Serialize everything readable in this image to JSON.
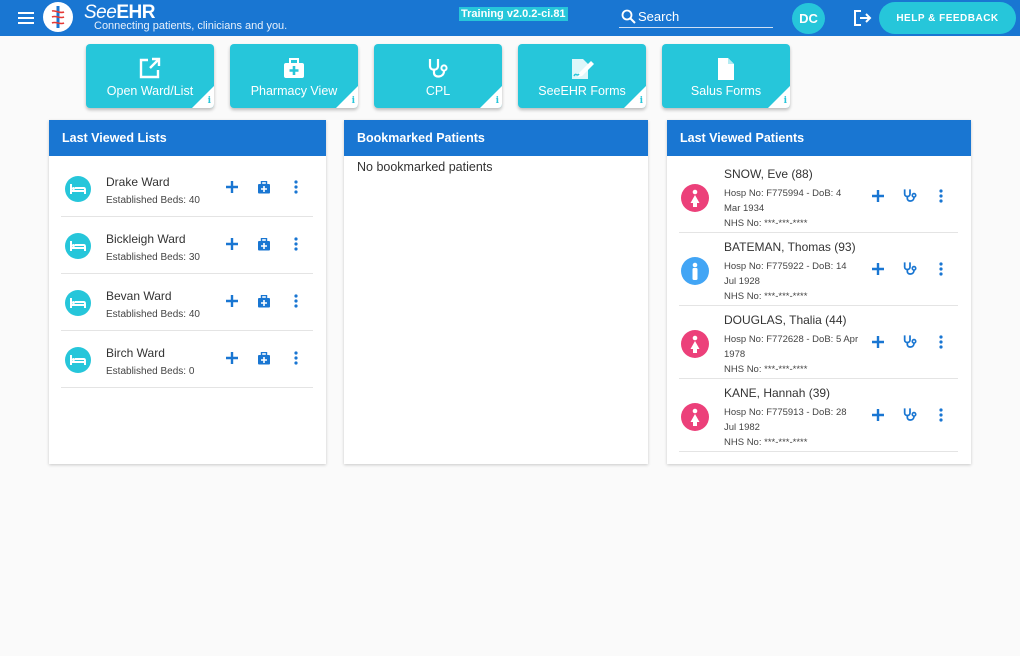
{
  "header": {
    "brand_prefix": "See",
    "brand_suffix": "EHR",
    "tagline": "Connecting patients, clinicians and you.",
    "environment": "Training v2.0.2-ci.81",
    "search_placeholder": "Search",
    "user_initials": "DC",
    "help_label": "HELP & FEEDBACK"
  },
  "tiles": [
    {
      "label": "Open Ward/List",
      "icon": "open-external-icon"
    },
    {
      "label": "Pharmacy View",
      "icon": "medical-bag-icon"
    },
    {
      "label": "CPL",
      "icon": "stethoscope-icon"
    },
    {
      "label": "SeeEHR Forms",
      "icon": "edit-form-icon"
    },
    {
      "label": "Salus Forms",
      "icon": "document-icon"
    }
  ],
  "tile_info_glyph": "i",
  "last_viewed_lists": {
    "title": "Last Viewed Lists",
    "items": [
      {
        "name": "Drake Ward",
        "beds": "Established Beds: 40"
      },
      {
        "name": "Bickleigh Ward",
        "beds": "Established Beds: 30"
      },
      {
        "name": "Bevan Ward",
        "beds": "Established Beds: 40"
      },
      {
        "name": "Birch Ward",
        "beds": "Established Beds: 0"
      }
    ]
  },
  "bookmarked": {
    "title": "Bookmarked Patients",
    "empty": "No bookmarked patients"
  },
  "last_viewed_patients": {
    "title": "Last Viewed Patients",
    "items": [
      {
        "name": "SNOW, Eve (88)",
        "hosp": "Hosp No: F775994 - DoB: 4 Mar 1934",
        "nhs": "NHS No: ***-***-****",
        "sex": "female"
      },
      {
        "name": "BATEMAN, Thomas (93)",
        "hosp": "Hosp No: F775922 - DoB: 14 Jul 1928",
        "nhs": "NHS No: ***-***-****",
        "sex": "male"
      },
      {
        "name": "DOUGLAS, Thalia (44)",
        "hosp": "Hosp No: F772628 - DoB: 5 Apr 1978",
        "nhs": "NHS No: ***-***-****",
        "sex": "female"
      },
      {
        "name": "KANE, Hannah (39)",
        "hosp": "Hosp No: F775913 - DoB: 28 Jul 1982",
        "nhs": "NHS No: ***-***-****",
        "sex": "female"
      }
    ]
  },
  "colors": {
    "primary": "#1976d2",
    "accent": "#26c6da",
    "female": "#ec407a",
    "male": "#42a5f5"
  }
}
